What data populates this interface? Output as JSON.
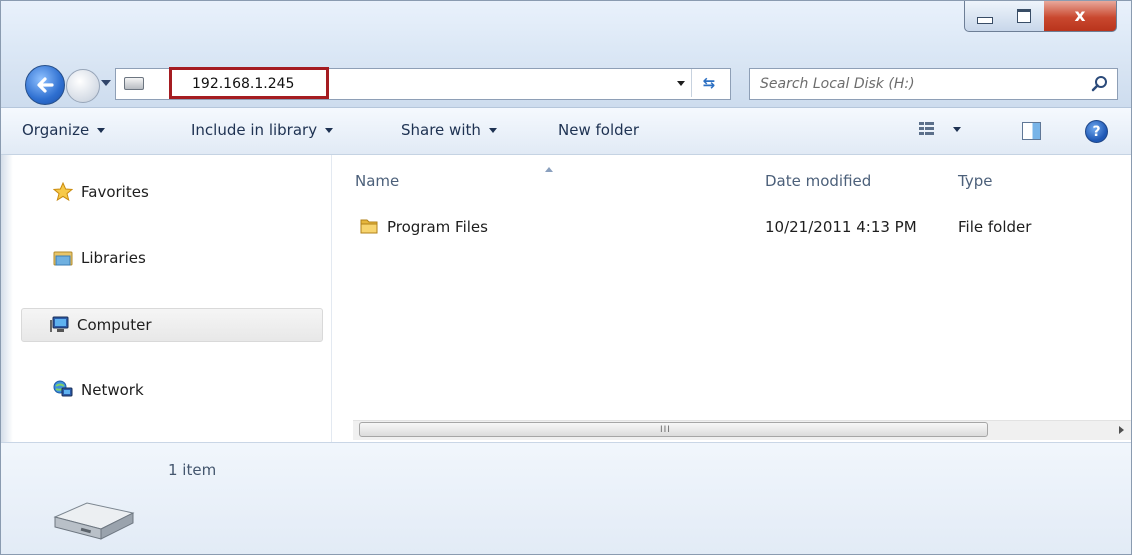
{
  "window": {
    "minimize_glyph": "minimize",
    "maximize_glyph": "maximize",
    "close_glyph": "x"
  },
  "nav": {
    "address_value": "192.168.1.245",
    "search_placeholder": "Search Local Disk (H:)",
    "highlight_color": "#a51c21"
  },
  "toolbar": {
    "organize": "Organize",
    "include_in_library": "Include in library",
    "share_with": "Share with",
    "new_folder": "New folder",
    "help_glyph": "?"
  },
  "sidebar": {
    "items": [
      {
        "label": "Favorites",
        "icon": "star-icon"
      },
      {
        "label": "Libraries",
        "icon": "libraries-icon"
      },
      {
        "label": "Computer",
        "icon": "computer-icon",
        "selected": true
      },
      {
        "label": "Network",
        "icon": "network-icon"
      }
    ]
  },
  "files": {
    "columns": [
      "Name",
      "Date modified",
      "Type"
    ],
    "rows": [
      {
        "name": "Program Files",
        "date": "10/21/2011 4:13 PM",
        "type": "File folder",
        "icon": "folder-icon"
      }
    ]
  },
  "scrollbar": {
    "grip": "III"
  },
  "details": {
    "item_count": "1 item",
    "icon": "drive-icon"
  }
}
